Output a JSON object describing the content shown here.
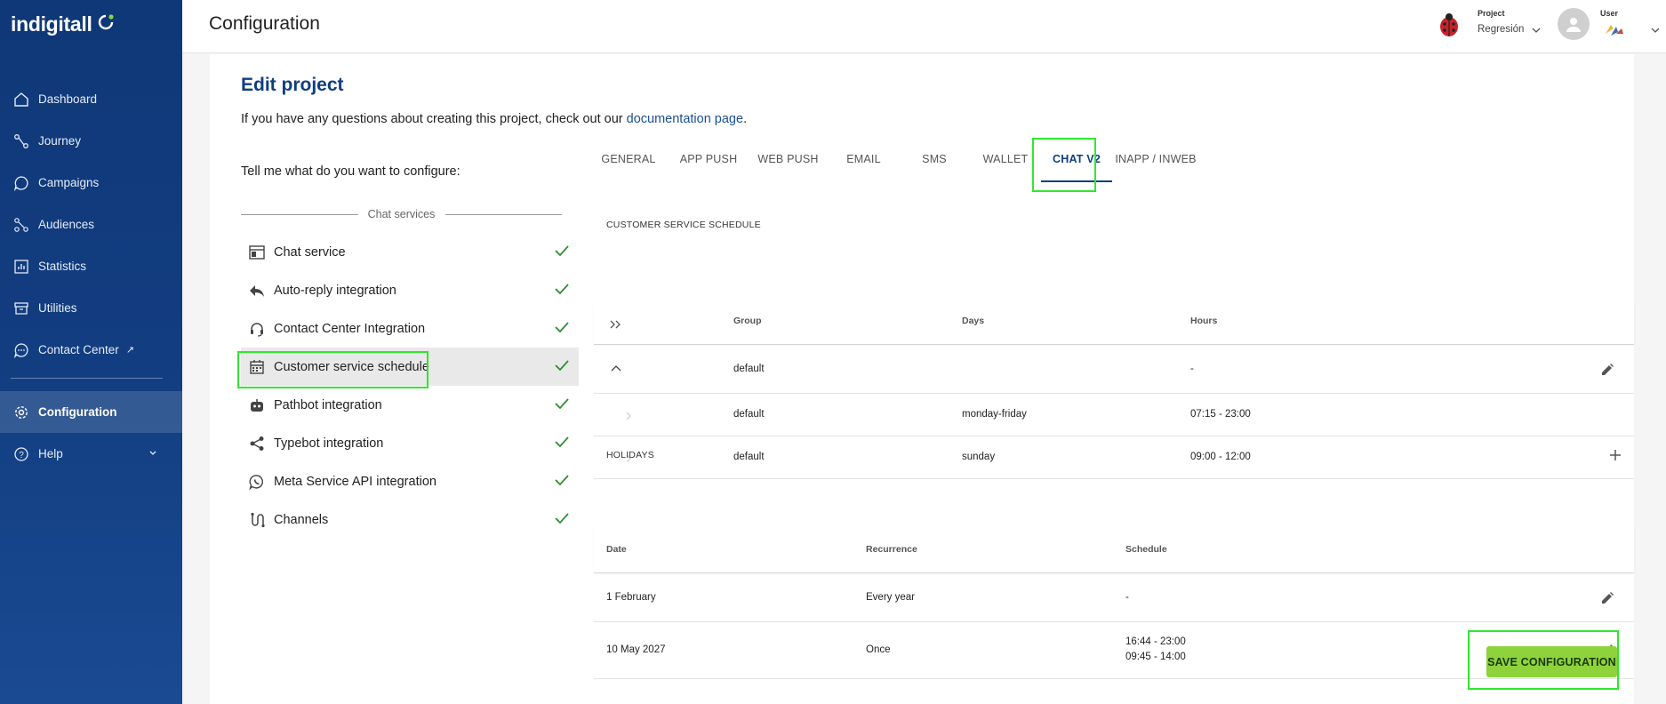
{
  "sidebar": {
    "logo": "indigitall",
    "items": [
      {
        "label": "Dashboard",
        "icon": "home-icon"
      },
      {
        "label": "Journey",
        "icon": "journey-icon"
      },
      {
        "label": "Campaigns",
        "icon": "chat-bubble-icon"
      },
      {
        "label": "Audiences",
        "icon": "audiences-icon"
      },
      {
        "label": "Statistics",
        "icon": "statistics-icon"
      },
      {
        "label": "Utilities",
        "icon": "archive-icon"
      },
      {
        "label": "Contact Center",
        "icon": "contact-center-icon",
        "external": true
      }
    ],
    "active_item": {
      "label": "Configuration",
      "icon": "gear-icon"
    },
    "help_item": {
      "label": "Help",
      "icon": "help-icon"
    }
  },
  "header": {
    "title": "Configuration",
    "project_label": "Project",
    "project_value": "Regresión",
    "user_label": "User"
  },
  "main": {
    "title": "Edit project",
    "info_prefix": "If you have any questions about creating this project, check out our ",
    "info_link": "documentation page",
    "info_suffix": ".",
    "configure_label": "Tell me what do you want to configure:",
    "section_label": "Chat services",
    "config_items": [
      {
        "label": "Chat service",
        "icon": "browser-window-icon",
        "done": true
      },
      {
        "label": "Auto-reply integration",
        "icon": "reply-icon",
        "done": true
      },
      {
        "label": "Contact Center Integration",
        "icon": "headset-icon",
        "done": true
      },
      {
        "label": "Customer service schedule",
        "icon": "calendar-icon",
        "done": true,
        "selected": true
      },
      {
        "label": "Pathbot integration",
        "icon": "robot-icon",
        "done": true
      },
      {
        "label": "Typebot integration",
        "icon": "share-icon",
        "done": true
      },
      {
        "label": "Meta Service API integration",
        "icon": "whatsapp-icon",
        "done": true
      },
      {
        "label": "Channels",
        "icon": "channels-icon",
        "done": true
      }
    ],
    "tabs": [
      "GENERAL",
      "APP PUSH",
      "WEB PUSH",
      "EMAIL",
      "SMS",
      "WALLET",
      "CHAT V2",
      "INAPP / INWEB"
    ],
    "active_tab": "CHAT V2",
    "schedule": {
      "heading": "CUSTOMER SERVICE SCHEDULE",
      "columns": [
        "Group",
        "Days",
        "Hours"
      ],
      "group_row": {
        "group": "default",
        "days": "",
        "hours": "-"
      },
      "rows": [
        {
          "group": "default",
          "days": "monday-friday",
          "hours": "07:15 - 23:00"
        },
        {
          "group": "default",
          "days": "sunday",
          "hours": "09:00 - 12:00"
        }
      ]
    },
    "holidays": {
      "heading": "HOLIDAYS",
      "columns": [
        "Date",
        "Recurrence",
        "Schedule"
      ],
      "rows": [
        {
          "date": "1 February",
          "recurrence": "Every year",
          "schedule": [
            "-"
          ]
        },
        {
          "date": "10 May 2027",
          "recurrence": "Once",
          "schedule": [
            "16:44 - 23:00",
            "09:45 - 14:00"
          ]
        }
      ]
    },
    "save_label": "SAVE CONFIGURATION"
  },
  "colors": {
    "sidebar_bg": "#123d80",
    "brand_blue": "#0f3e80",
    "save_green": "#8ed23c",
    "check_green": "#2e8b2e",
    "highlight": "#2ee82e"
  }
}
